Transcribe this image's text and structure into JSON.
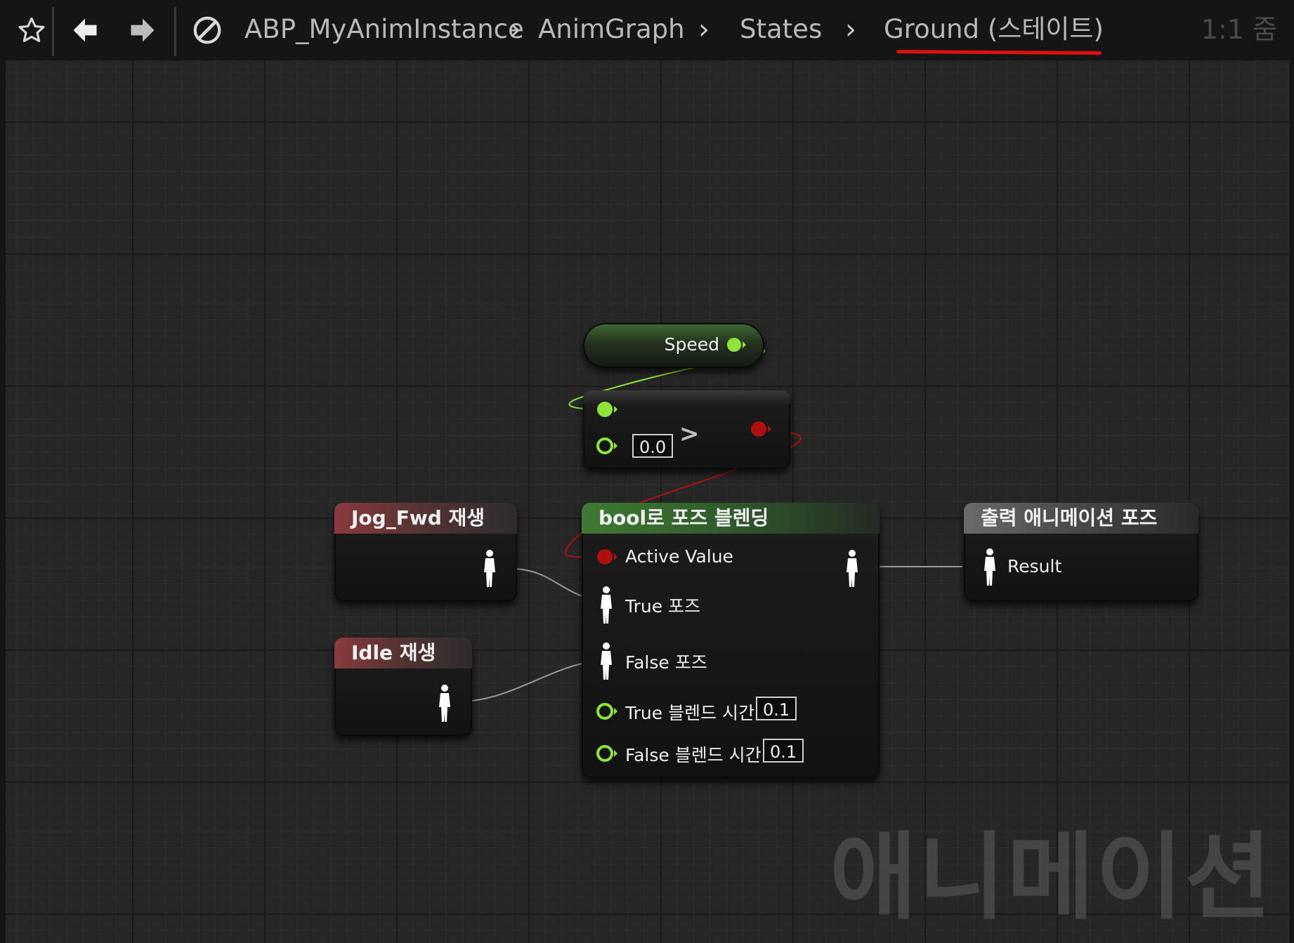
{
  "toolbar": {
    "breadcrumbs": [
      "ABP_MyAnimInstance",
      "AnimGraph",
      "States",
      "Ground (스테이트)"
    ],
    "zoom": "1:1 줌",
    "icons": [
      "star-icon",
      "back-arrow-icon",
      "forward-arrow-icon",
      "disabled-circle-icon"
    ],
    "highlight_color": "#e01010"
  },
  "nodes": {
    "speed": {
      "label": "Speed"
    },
    "compare": {
      "operator": ">",
      "value": "0.0"
    },
    "blend": {
      "title": "bool로 포즈 블렌딩",
      "active_value": "Active Value",
      "true_pose": "True 포즈",
      "false_pose": "False 포즈",
      "true_blend_time": "True 블렌드 시간",
      "true_blend_value": "0.1",
      "false_blend_time": "False 블렌드 시간",
      "false_blend_value": "0.1"
    },
    "jog": {
      "title": "Jog_Fwd 재생"
    },
    "idle": {
      "title": "Idle 재생"
    },
    "output": {
      "title": "출력 애니메이션 포즈",
      "result": "Result"
    }
  },
  "watermark": "애니메이션",
  "colors": {
    "float_pin": "#8fe33a",
    "bool_pin": "#b01010",
    "pose_pin": "#ffffff"
  }
}
